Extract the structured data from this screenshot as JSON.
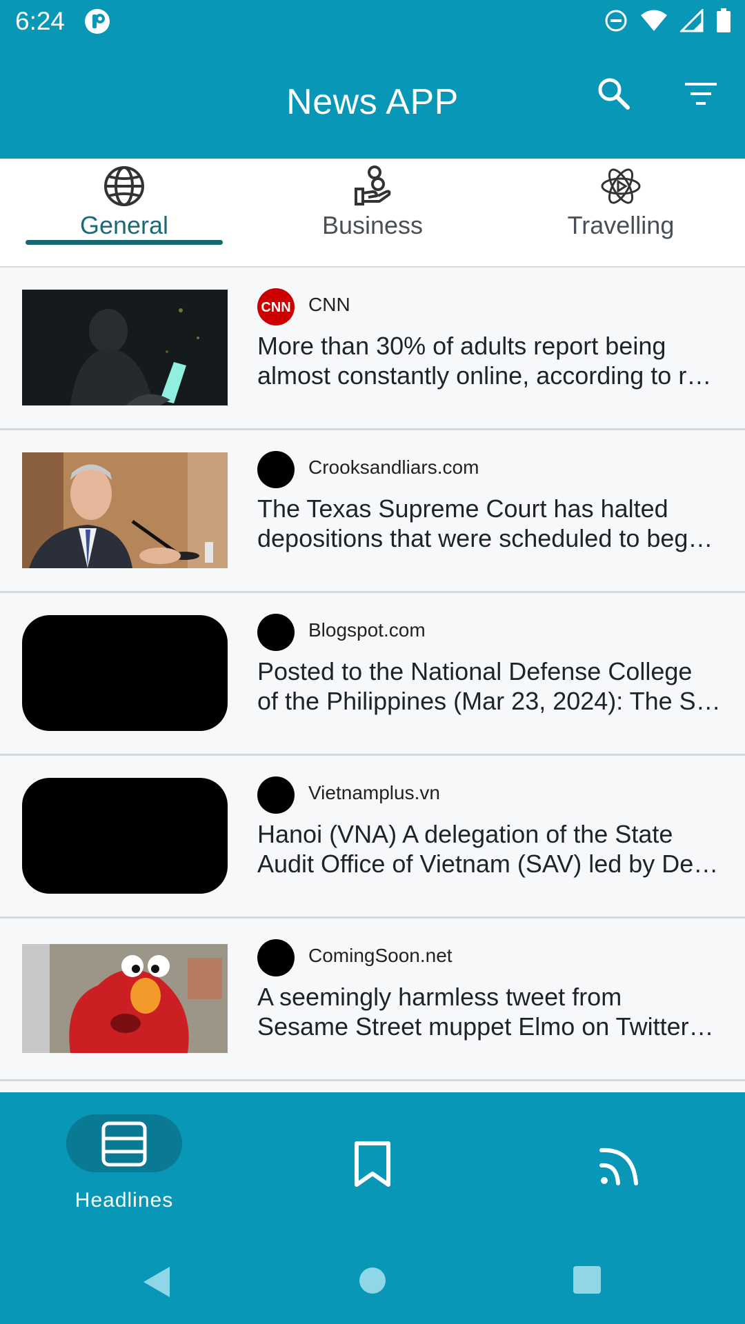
{
  "status_bar": {
    "time": "6:24",
    "icons": [
      "app-indicator-icon",
      "dnd-icon",
      "wifi-icon",
      "signal-icon",
      "battery-icon"
    ]
  },
  "app_bar": {
    "title": "News APP",
    "actions": [
      "search-icon",
      "filter-icon"
    ]
  },
  "tabs": [
    {
      "label": "General",
      "icon": "globe-icon",
      "active": true
    },
    {
      "label": "Business",
      "icon": "business-hand-icon",
      "active": false
    },
    {
      "label": "Travelling",
      "icon": "atom-play-icon",
      "active": false
    }
  ],
  "articles": [
    {
      "source": "CNN",
      "headline_line1": "More than 30% of adults report being",
      "headline_line2": "almost constantly online, according to r…"
    },
    {
      "source": "Crooksandliars.com",
      "headline_line1": "The Texas Supreme Court has halted",
      "headline_line2": "depositions that were scheduled to beg…"
    },
    {
      "source": "Blogspot.com",
      "headline_line1": "Posted to the National Defense College",
      "headline_line2": "of the Philippines (Mar 23, 2024): The S…"
    },
    {
      "source": "Vietnamplus.vn",
      "headline_line1": "Hanoi (VNA) A delegation of the State",
      "headline_line2": "Audit Office of Vietnam (SAV) led by De…"
    },
    {
      "source": "ComingSoon.net",
      "headline_line1": "A seemingly harmless tweet from",
      "headline_line2": "Sesame Street muppet Elmo on Twitter…"
    }
  ],
  "bottom_nav": {
    "items": [
      {
        "label": "Headlines",
        "icon": "headlines-icon",
        "active": true
      },
      {
        "label": "",
        "icon": "bookmark-icon",
        "active": false
      },
      {
        "label": "",
        "icon": "feed-icon",
        "active": false
      }
    ]
  },
  "colors": {
    "primary": "#0897b7",
    "tab_active": "#16656f",
    "cnn_red": "#cc0000"
  }
}
